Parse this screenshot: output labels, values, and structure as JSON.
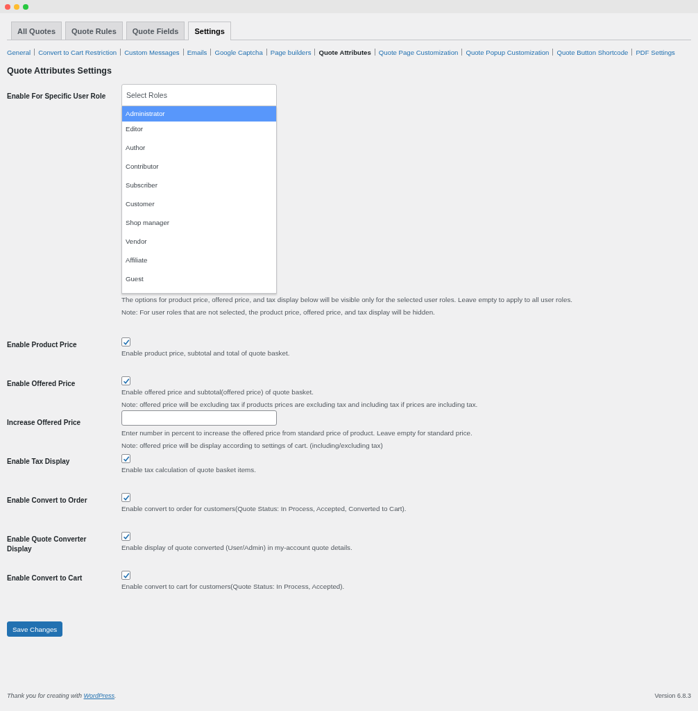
{
  "tabs": [
    {
      "label": "All Quotes",
      "selected": false
    },
    {
      "label": "Quote Rules",
      "selected": false
    },
    {
      "label": "Quote Fields",
      "selected": false
    },
    {
      "label": "Settings",
      "selected": true
    }
  ],
  "subnav": [
    {
      "label": "General",
      "selected": false
    },
    {
      "label": "Convert to Cart Restriction",
      "selected": false
    },
    {
      "label": "Custom Messages",
      "selected": false
    },
    {
      "label": "Emails",
      "selected": false
    },
    {
      "label": "Google Captcha",
      "selected": false
    },
    {
      "label": "Page builders",
      "selected": false
    },
    {
      "label": "Quote Attributes",
      "selected": true
    },
    {
      "label": "Quote Page Customization",
      "selected": false
    },
    {
      "label": "Quote Popup Customization",
      "selected": false
    },
    {
      "label": "Quote Button Shortcode",
      "selected": false
    },
    {
      "label": "PDF Settings",
      "selected": false
    }
  ],
  "heading": "Quote Attributes Settings",
  "settings": [
    {
      "kind": "roles",
      "label": "Enable For Specific User Role",
      "placeholder": "Select Roles",
      "options": [
        {
          "label": "Administrator",
          "selected": true
        },
        {
          "label": "Editor",
          "selected": false
        },
        {
          "label": "Author",
          "selected": false
        },
        {
          "label": "Contributor",
          "selected": false
        },
        {
          "label": "Subscriber",
          "selected": false
        },
        {
          "label": "Customer",
          "selected": false
        },
        {
          "label": "Shop manager",
          "selected": false
        },
        {
          "label": "Vendor",
          "selected": false
        },
        {
          "label": "Affiliate",
          "selected": false
        },
        {
          "label": "Guest",
          "selected": false
        }
      ],
      "notes": [
        "The options for product price, offered price, and tax display below will be visible only for the selected user roles. Leave empty to apply to all user roles.",
        "Note: For user roles that are not selected, the product price, offered price, and tax display will be hidden."
      ]
    },
    {
      "kind": "checkbox",
      "label": "Enable Product Price",
      "checked": true,
      "notes": [
        "Enable product price, subtotal and total of quote basket."
      ]
    },
    {
      "kind": "checkbox",
      "label": "Enable Offered Price",
      "checked": true,
      "notes": [
        "Enable offered price and subtotal(offered price) of quote basket.",
        "Note: offered price will be excluding tax if products prices are excluding tax and including tax if prices are including tax."
      ]
    },
    {
      "kind": "number",
      "label": "Increase Offered Price",
      "notes": [
        "Enter number in percent to increase the offered price from standard price of product. Leave empty for standard price.",
        "Note: offered price will be display according to settings of cart. (including/excluding tax)"
      ]
    },
    {
      "kind": "checkbox",
      "label": "Enable Tax Display",
      "checked": true,
      "notes": [
        "Enable tax calculation of quote basket items."
      ]
    },
    {
      "kind": "checkbox",
      "label": "Enable Convert to Order",
      "checked": true,
      "notes": [
        "Enable convert to order for customers(Quote Status: In Process, Accepted, Converted to Cart)."
      ]
    },
    {
      "kind": "checkbox",
      "label": "Enable Quote Converter Display",
      "checked": true,
      "notes": [
        "Enable display of quote converted (User/Admin) in my-account quote details."
      ]
    },
    {
      "kind": "checkbox",
      "label": "Enable Convert to Cart",
      "checked": true,
      "notes": [
        "Enable convert to cart for customers(Quote Status: In Process, Accepted)."
      ]
    }
  ],
  "save_button": "Save Changes",
  "footer": {
    "credit_start": "Thank you for creating with ",
    "credit_link": "WordPress",
    "credit_end": ".",
    "version": "Version 6.8.3"
  }
}
